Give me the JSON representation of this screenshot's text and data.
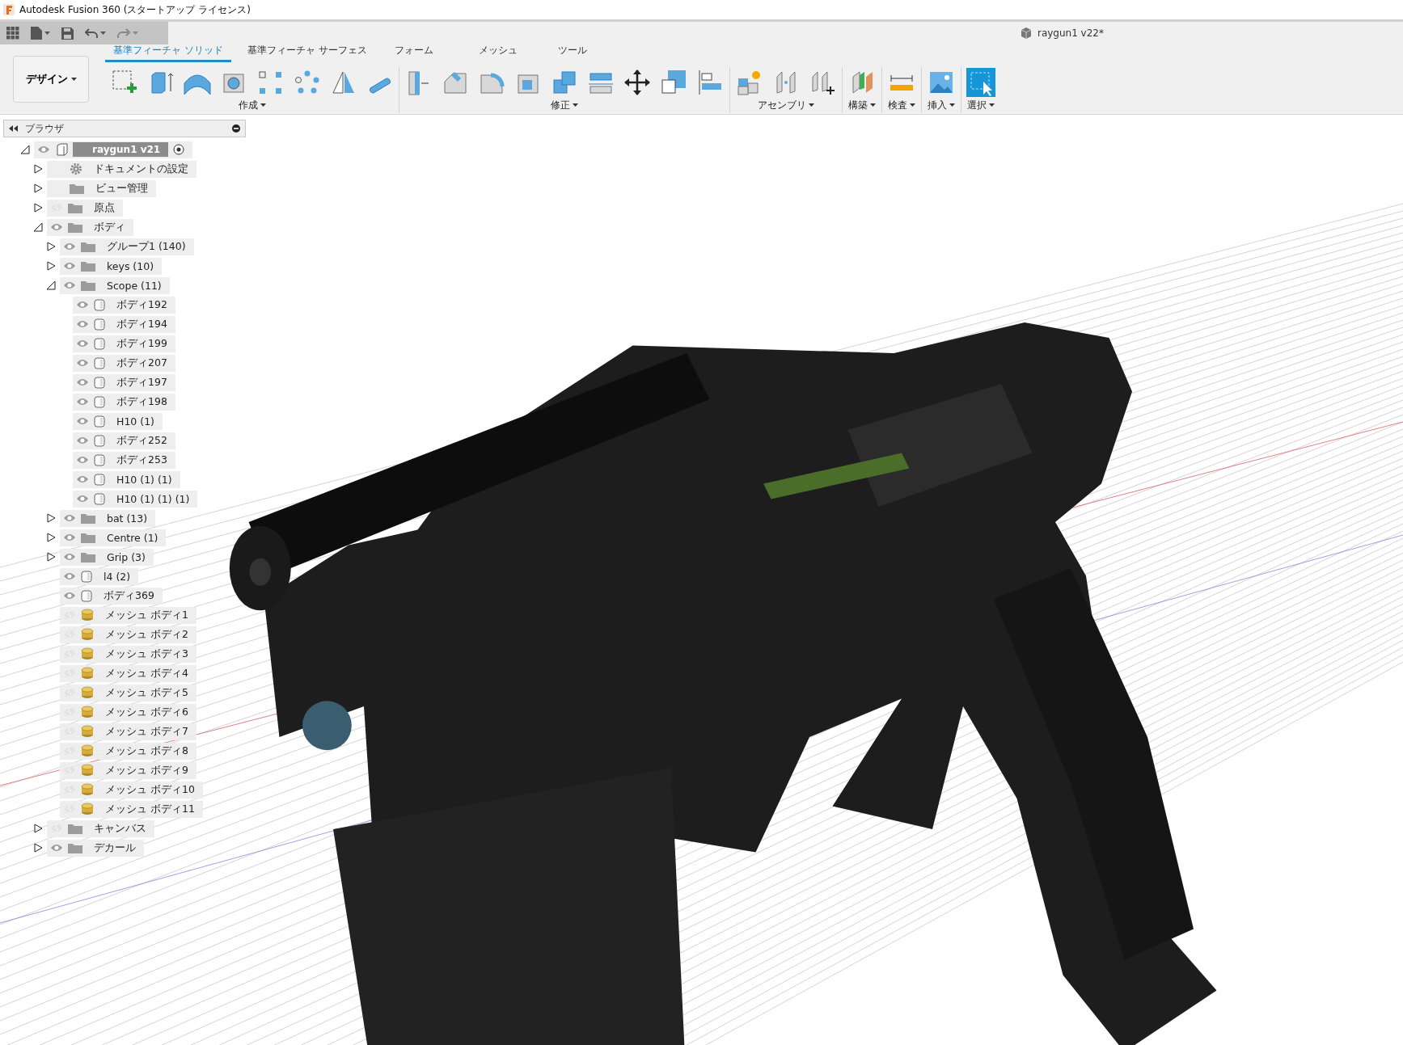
{
  "window": {
    "title": "Autodesk Fusion 360 (スタートアップ ライセンス)"
  },
  "document_title": "raygun1 v22*",
  "workspace": {
    "label": "デザイン"
  },
  "tabs": [
    {
      "label": "基準フィーチャ ソリッド",
      "selected": true
    },
    {
      "label": "基準フィーチャ サーフェス",
      "selected": false
    },
    {
      "label": "フォーム",
      "selected": false
    },
    {
      "label": "メッシュ",
      "selected": false
    },
    {
      "label": "ツール",
      "selected": false
    }
  ],
  "groups": [
    {
      "label": "作成"
    },
    {
      "label": "修正"
    },
    {
      "label": "アセンブリ"
    },
    {
      "label": "構築"
    },
    {
      "label": "検査"
    },
    {
      "label": "挿入"
    },
    {
      "label": "選択"
    }
  ],
  "browser": {
    "title": "ブラウザ",
    "tree": [
      {
        "label": "raygun1 v21",
        "kind": "component",
        "visible": true,
        "expanded": true,
        "children": [
          {
            "label": "ドキュメントの設定",
            "kind": "settings",
            "expanded": false
          },
          {
            "label": "ビュー管理",
            "kind": "folder",
            "expanded": false
          },
          {
            "label": "原点",
            "kind": "folder",
            "visible": false,
            "expanded": false
          },
          {
            "label": "ボディ",
            "kind": "folder",
            "visible": true,
            "expanded": true,
            "children": [
              {
                "label": "グループ1 (140)",
                "kind": "folder",
                "visible": true,
                "expanded": false
              },
              {
                "label": "keys (10)",
                "kind": "folder",
                "visible": true,
                "expanded": false
              },
              {
                "label": "Scope (11)",
                "kind": "folder",
                "visible": true,
                "expanded": true,
                "children": [
                  {
                    "label": "ボディ192",
                    "kind": "body",
                    "visible": true
                  },
                  {
                    "label": "ボディ194",
                    "kind": "body",
                    "visible": true
                  },
                  {
                    "label": "ボディ199",
                    "kind": "body",
                    "visible": true
                  },
                  {
                    "label": "ボディ207",
                    "kind": "body",
                    "visible": true
                  },
                  {
                    "label": "ボディ197",
                    "kind": "body",
                    "visible": true
                  },
                  {
                    "label": "ボディ198",
                    "kind": "body",
                    "visible": true
                  },
                  {
                    "label": "H10 (1)",
                    "kind": "body",
                    "visible": true
                  },
                  {
                    "label": "ボディ252",
                    "kind": "body",
                    "visible": true
                  },
                  {
                    "label": "ボディ253",
                    "kind": "body",
                    "visible": true
                  },
                  {
                    "label": "H10 (1) (1)",
                    "kind": "body",
                    "visible": true
                  },
                  {
                    "label": "H10 (1) (1) (1)",
                    "kind": "body",
                    "visible": true
                  }
                ]
              },
              {
                "label": "bat (13)",
                "kind": "folder",
                "visible": true,
                "expanded": false
              },
              {
                "label": "Centre (1)",
                "kind": "folder",
                "visible": true,
                "expanded": false
              },
              {
                "label": "Grip (3)",
                "kind": "folder",
                "visible": true,
                "expanded": false
              },
              {
                "label": "l4 (2)",
                "kind": "body",
                "visible": true
              },
              {
                "label": "ボディ369",
                "kind": "body",
                "visible": true
              },
              {
                "label": "メッシュ ボディ1",
                "kind": "mesh",
                "visible": false
              },
              {
                "label": "メッシュ ボディ2",
                "kind": "mesh",
                "visible": false
              },
              {
                "label": "メッシュ ボディ3",
                "kind": "mesh",
                "visible": false
              },
              {
                "label": "メッシュ ボディ4",
                "kind": "mesh",
                "visible": false
              },
              {
                "label": "メッシュ ボディ5",
                "kind": "mesh",
                "visible": false
              },
              {
                "label": "メッシュ ボディ6",
                "kind": "mesh",
                "visible": false
              },
              {
                "label": "メッシュ ボディ7",
                "kind": "mesh",
                "visible": false
              },
              {
                "label": "メッシュ ボディ8",
                "kind": "mesh",
                "visible": false
              },
              {
                "label": "メッシュ ボディ9",
                "kind": "mesh",
                "visible": false
              },
              {
                "label": "メッシュ ボディ10",
                "kind": "mesh",
                "visible": false
              },
              {
                "label": "メッシュ ボディ11",
                "kind": "mesh",
                "visible": false
              }
            ]
          },
          {
            "label": "キャンバス",
            "kind": "folder",
            "visible": false,
            "expanded": false
          },
          {
            "label": "デカール",
            "kind": "folder",
            "visible": true,
            "expanded": false
          }
        ]
      }
    ]
  }
}
